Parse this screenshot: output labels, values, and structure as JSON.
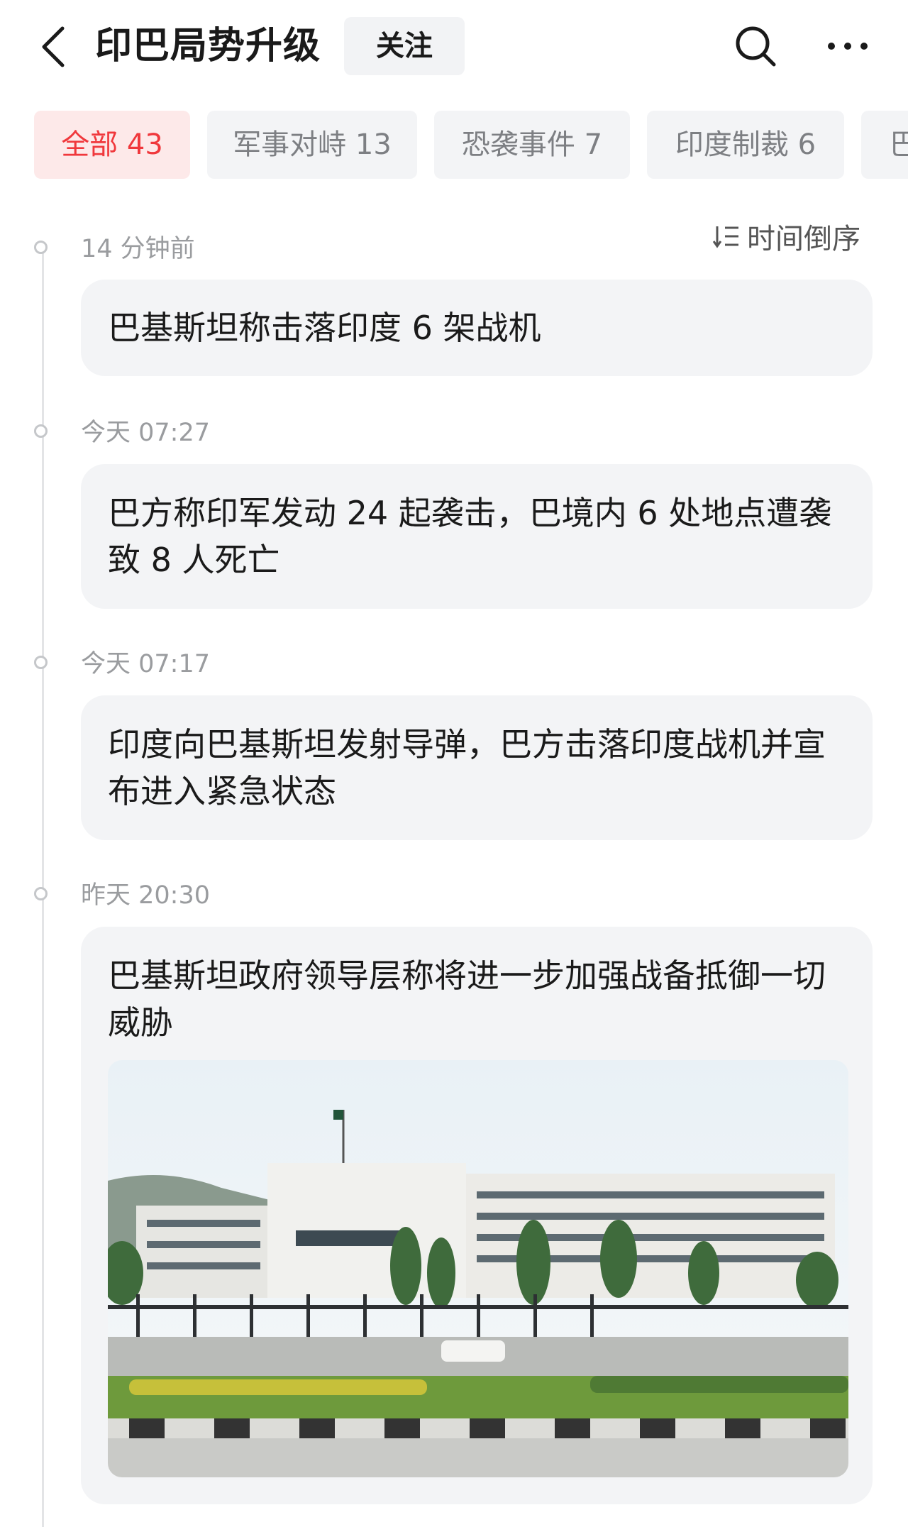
{
  "header": {
    "title": "印巴局势升级",
    "follow_label": "关注"
  },
  "tabs": [
    {
      "label": "全部 43",
      "active": true
    },
    {
      "label": "军事对峙 13",
      "active": false
    },
    {
      "label": "恐袭事件 7",
      "active": false
    },
    {
      "label": "印度制裁 6",
      "active": false
    },
    {
      "label": "巴",
      "active": false
    }
  ],
  "sort": {
    "label": "时间倒序"
  },
  "timeline": [
    {
      "time": "14 分钟前",
      "text": "巴基斯坦称击落印度 6 架战机"
    },
    {
      "time": "今天 07:27",
      "text": "巴方称印军发动 24 起袭击，巴境内 6 处地点遭袭致 8 人死亡"
    },
    {
      "time": "今天 07:17",
      "text": "印度向巴基斯坦发射导弹，巴方击落印度战机并宣布进入紧急状态"
    },
    {
      "time": "昨天 20:30",
      "text": "巴基斯坦政府领导层称将进一步加强战备抵御一切威胁"
    }
  ],
  "colors": {
    "accent": "#f0383c",
    "accent_bg": "#fde9e9",
    "card_bg": "#f3f4f6",
    "muted_text": "#9a9c9f"
  },
  "icons": [
    "back-arrow-icon",
    "search-icon",
    "more-icon",
    "sort-icon"
  ]
}
